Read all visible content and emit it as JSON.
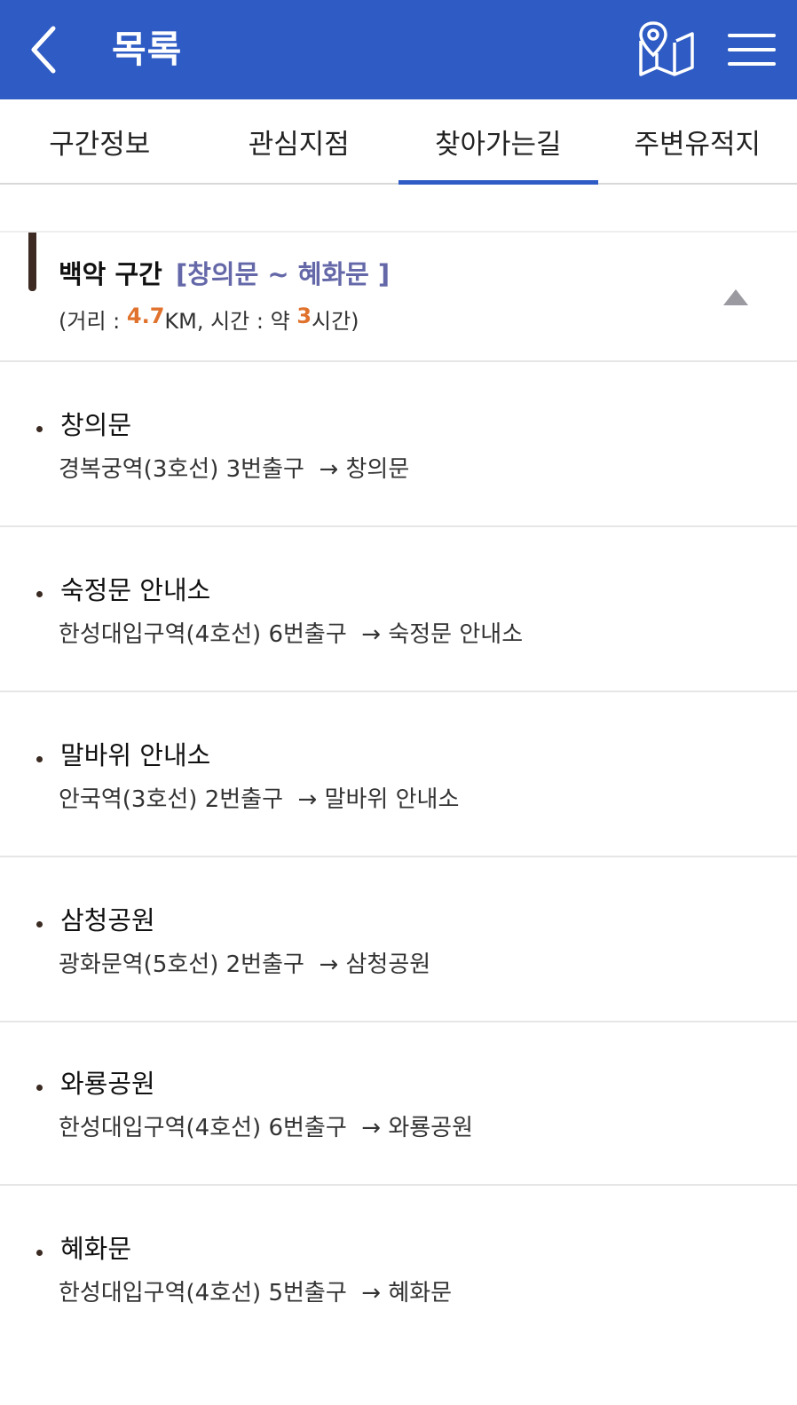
{
  "header": {
    "title": "목록",
    "icons": {
      "back": "chevron-left-icon",
      "map": "map-pin-icon",
      "menu": "hamburger-menu-icon"
    },
    "color": "#2f5cc4"
  },
  "tabs": [
    {
      "label": "구간정보",
      "active": false
    },
    {
      "label": "관심지점",
      "active": false
    },
    {
      "label": "찾아가는길",
      "active": true
    },
    {
      "label": "주변유적지",
      "active": false
    }
  ],
  "section": {
    "name": "백악 구간",
    "range": "[창의문 ~ 혜화문 ]",
    "info_prefix": "(거리 : ",
    "distance": "4.7",
    "distance_unit": "KM, 시간 : 약 ",
    "time": "3",
    "time_suffix": "시간)",
    "accent_color": "#e0722e",
    "range_color": "#6468a8",
    "collapse_icon": "triangle-up-icon"
  },
  "routes": [
    {
      "name": "창의문",
      "directions": "경복궁역(3호선) 3번출구  → 창의문"
    },
    {
      "name": "숙정문 안내소",
      "directions": "한성대입구역(4호선) 6번출구  → 숙정문 안내소"
    },
    {
      "name": "말바위 안내소",
      "directions": "안국역(3호선) 2번출구  → 말바위 안내소"
    },
    {
      "name": "삼청공원",
      "directions": "광화문역(5호선) 2번출구  → 삼청공원"
    },
    {
      "name": "와룡공원",
      "directions": "한성대입구역(4호선) 6번출구  → 와룡공원"
    },
    {
      "name": "혜화문",
      "directions": "한성대입구역(4호선) 5번출구  → 혜화문"
    }
  ]
}
